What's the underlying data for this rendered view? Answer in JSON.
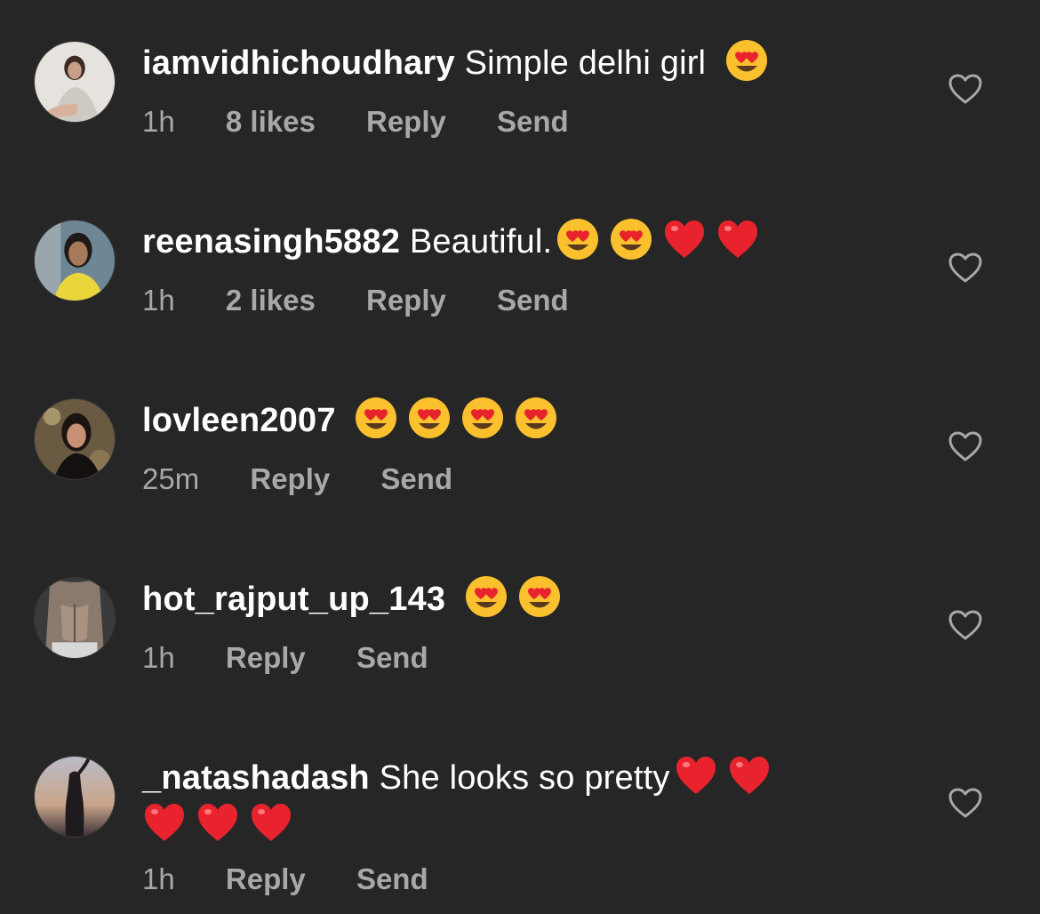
{
  "comments": [
    {
      "username": "iamvidhichoudhary",
      "text": "Simple delhi girl",
      "time": "1h",
      "likes": "8 likes",
      "reply": "Reply",
      "send": "Send",
      "emojis": [
        "heart-eyes"
      ],
      "avatar_color": "#d9d4cf"
    },
    {
      "username": "reenasingh5882",
      "text": "Beautiful.",
      "time": "1h",
      "likes": "2 likes",
      "reply": "Reply",
      "send": "Send",
      "emojis": [
        "heart-eyes",
        "heart-eyes",
        "red-heart",
        "red-heart"
      ],
      "avatar_color": "#5a6e78"
    },
    {
      "username": "lovleen2007",
      "text": "",
      "time": "25m",
      "reply": "Reply",
      "send": "Send",
      "emojis": [
        "heart-eyes",
        "heart-eyes",
        "heart-eyes",
        "heart-eyes"
      ],
      "avatar_color": "#7a6a52"
    },
    {
      "username": "hot_rajput_up_143",
      "text": "",
      "time": "1h",
      "reply": "Reply",
      "send": "Send",
      "emojis": [
        "heart-eyes",
        "heart-eyes"
      ],
      "avatar_color": "#4a4a4a"
    },
    {
      "username": "_natashadash",
      "text": "She looks so pretty",
      "time": "1h",
      "reply": "Reply",
      "send": "Send",
      "emojis": [
        "red-heart",
        "red-heart",
        "red-heart",
        "red-heart",
        "red-heart"
      ],
      "avatar_color": "#8a8f9a"
    }
  ],
  "colors": {
    "background": "#262626",
    "primary_text": "#ffffff",
    "secondary_text": "#a8a8a8",
    "heart_red": "#e8232d",
    "emoji_yellow": "#fbc02d"
  },
  "icons": {
    "like": "heart-outline-icon"
  }
}
